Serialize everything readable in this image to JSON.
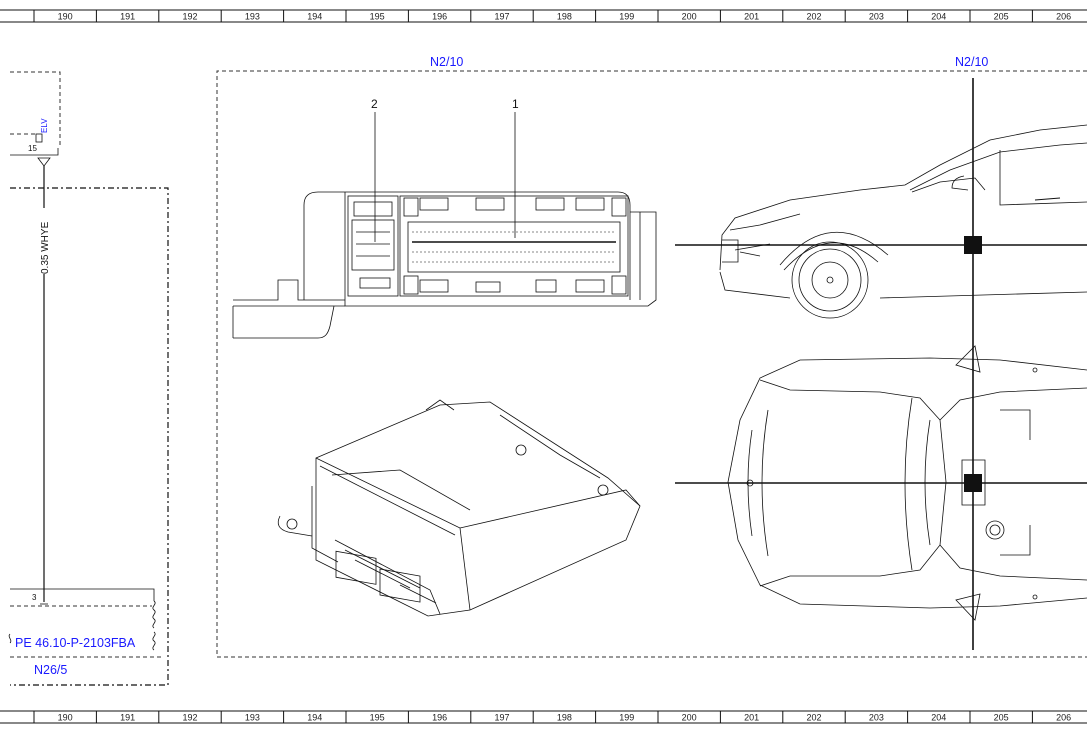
{
  "ruler": {
    "columns": [
      "190",
      "191",
      "192",
      "193",
      "194",
      "195",
      "196",
      "197",
      "198",
      "199",
      "200",
      "201",
      "202",
      "203",
      "204",
      "205",
      "206"
    ]
  },
  "labels": {
    "component_left_id": "N2/10",
    "component_right_id": "N2/10",
    "callout_1": "1",
    "callout_2": "2",
    "pin_15": "15",
    "pin_3": "3",
    "circuit_elv": "ELV",
    "wire_label": "0.35 WHYE",
    "ref_page": "PE 46.10-P-2103FBA",
    "ref_component": "N26/5"
  },
  "colors": {
    "link_blue": "#1a1aff",
    "line": "#111111"
  }
}
